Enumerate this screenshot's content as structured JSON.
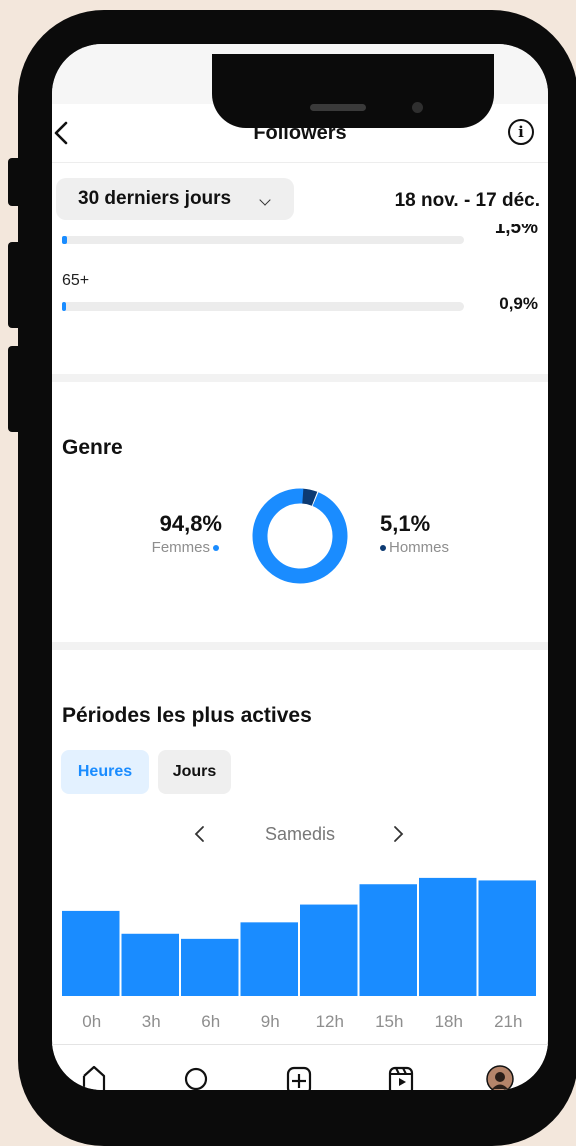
{
  "header": {
    "title": "Followers",
    "info_icon": "i"
  },
  "filter": {
    "period_label": "30 derniers jours",
    "date_range": "18 nov. - 17 déc."
  },
  "age": {
    "partial_row": {
      "value": "1,5%",
      "fraction": 0.015
    },
    "rows": [
      {
        "label": "65+",
        "value": "0,9%",
        "fraction": 0.009
      }
    ]
  },
  "gender": {
    "title": "Genre",
    "women": {
      "pct": "94,8%",
      "label": "Femmes",
      "color": "#1a8cff",
      "fraction": 0.948
    },
    "men": {
      "pct": "5,1%",
      "label": "Hommes",
      "color": "#0d3a72",
      "fraction": 0.051
    }
  },
  "active": {
    "title": "Périodes les plus actives",
    "tabs": {
      "hours": "Heures",
      "days": "Jours"
    },
    "day": "Samedis"
  },
  "chart_data": {
    "type": "bar",
    "categories": [
      "0h",
      "3h",
      "6h",
      "9h",
      "12h",
      "15h",
      "18h",
      "21h"
    ],
    "values": [
      67,
      49,
      45,
      58,
      72,
      88,
      93,
      91
    ],
    "ylim": [
      0,
      100
    ],
    "color": "#1a8cff"
  },
  "bottom_nav": [
    "home-icon",
    "search-icon",
    "create-icon",
    "reels-icon",
    "profile-avatar"
  ]
}
